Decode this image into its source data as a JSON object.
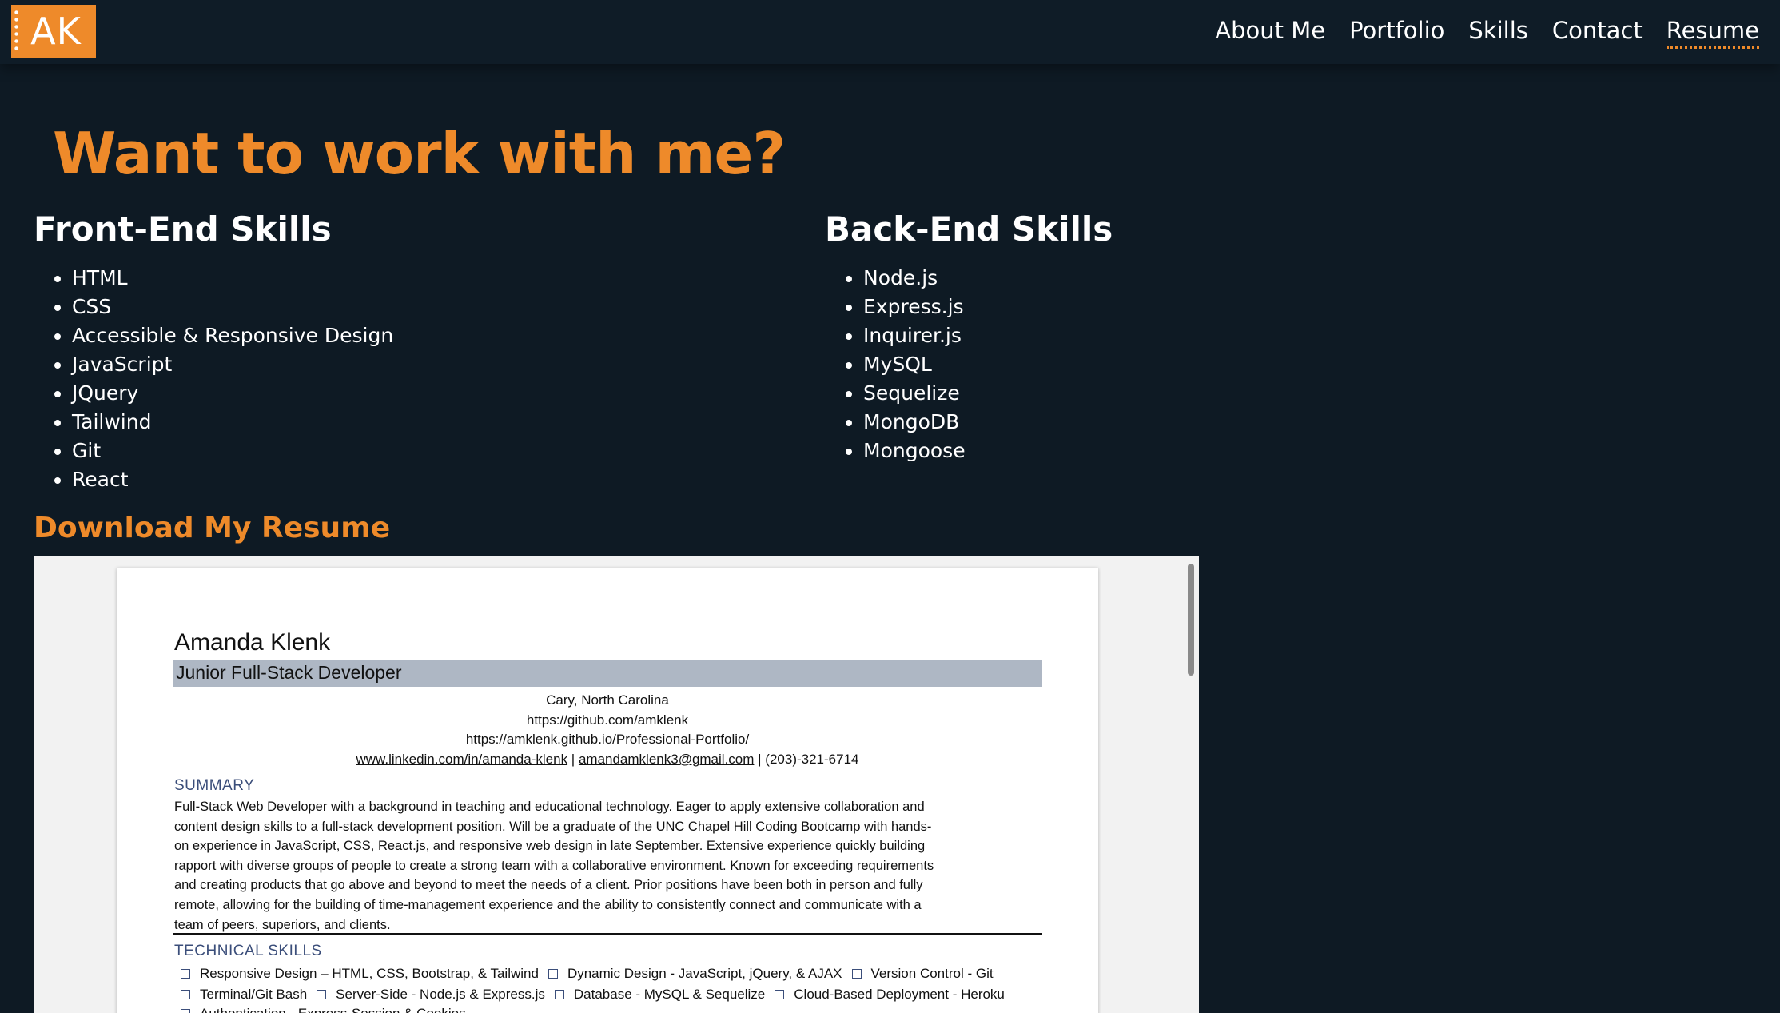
{
  "logo": {
    "text": "AK"
  },
  "nav": {
    "links": [
      {
        "label": "About Me"
      },
      {
        "label": "Portfolio"
      },
      {
        "label": "Skills"
      },
      {
        "label": "Contact"
      },
      {
        "label": "Resume"
      }
    ],
    "active": "Resume"
  },
  "hero": {
    "heading": "Want to work with me?"
  },
  "frontend": {
    "title": "Front-End Skills",
    "items": [
      "HTML",
      "CSS",
      "Accessible & Responsive Design",
      "JavaScript",
      "JQuery",
      "Tailwind",
      "Git",
      "React"
    ]
  },
  "backend": {
    "title": "Back-End Skills",
    "items": [
      "Node.js",
      "Express.js",
      "Inquirer.js",
      "MySQL",
      "Sequelize",
      "MongoDB",
      "Mongoose"
    ]
  },
  "download": {
    "label": "Download My Resume"
  },
  "resume": {
    "name": "Amanda Klenk",
    "title": "Junior Full-Stack Developer",
    "location": "Cary, North Carolina",
    "github": "https://github.com/amklenk",
    "portfolio": "https://amklenk.github.io/Professional-Portfolio/",
    "linkedin": "www.linkedin.com/in/amanda-klenk",
    "separator": "|",
    "email": "amandamklenk3@gmail.com",
    "phone": "| (203)-321-6714",
    "summary_heading": "SUMMARY",
    "summary_lines": [
      "Full-Stack Web Developer with a background in teaching and educational technology. Eager to apply extensive collaboration and",
      "content design skills to a full-stack development position. Will be a graduate of the UNC Chapel Hill Coding Bootcamp with hands-",
      "on experience in JavaScript, CSS, React.js, and responsive web design in late September. Extensive experience quickly building",
      "rapport with diverse groups of people to create a strong team with a collaborative environment. Known for exceeding requirements",
      "and creating products that go above and beyond to meet the needs of a client. Prior positions have been both in person and fully",
      "remote, allowing for the building of time-management experience and the ability to consistently connect and communicate with a",
      "team of peers, superiors, and clients."
    ],
    "skills_heading": "TECHNICAL SKILLS",
    "skills_rows": [
      [
        "Responsive Design – HTML, CSS, Bootstrap, & Tailwind",
        "Dynamic Design - JavaScript, jQuery, & AJAX",
        "Version Control - Git"
      ],
      [
        "Terminal/Git Bash",
        "Server-Side - Node.js & Express.js",
        "Database - MySQL & Sequelize",
        "Cloud-Based Deployment - Heroku"
      ],
      [
        "Authentication - Express-Session & Cookies"
      ]
    ]
  },
  "colors": {
    "accent": "#ee8a2a",
    "background": "#0e1a24",
    "resume_band": "#aeb7c4",
    "resume_heading": "#3b4e7a"
  }
}
